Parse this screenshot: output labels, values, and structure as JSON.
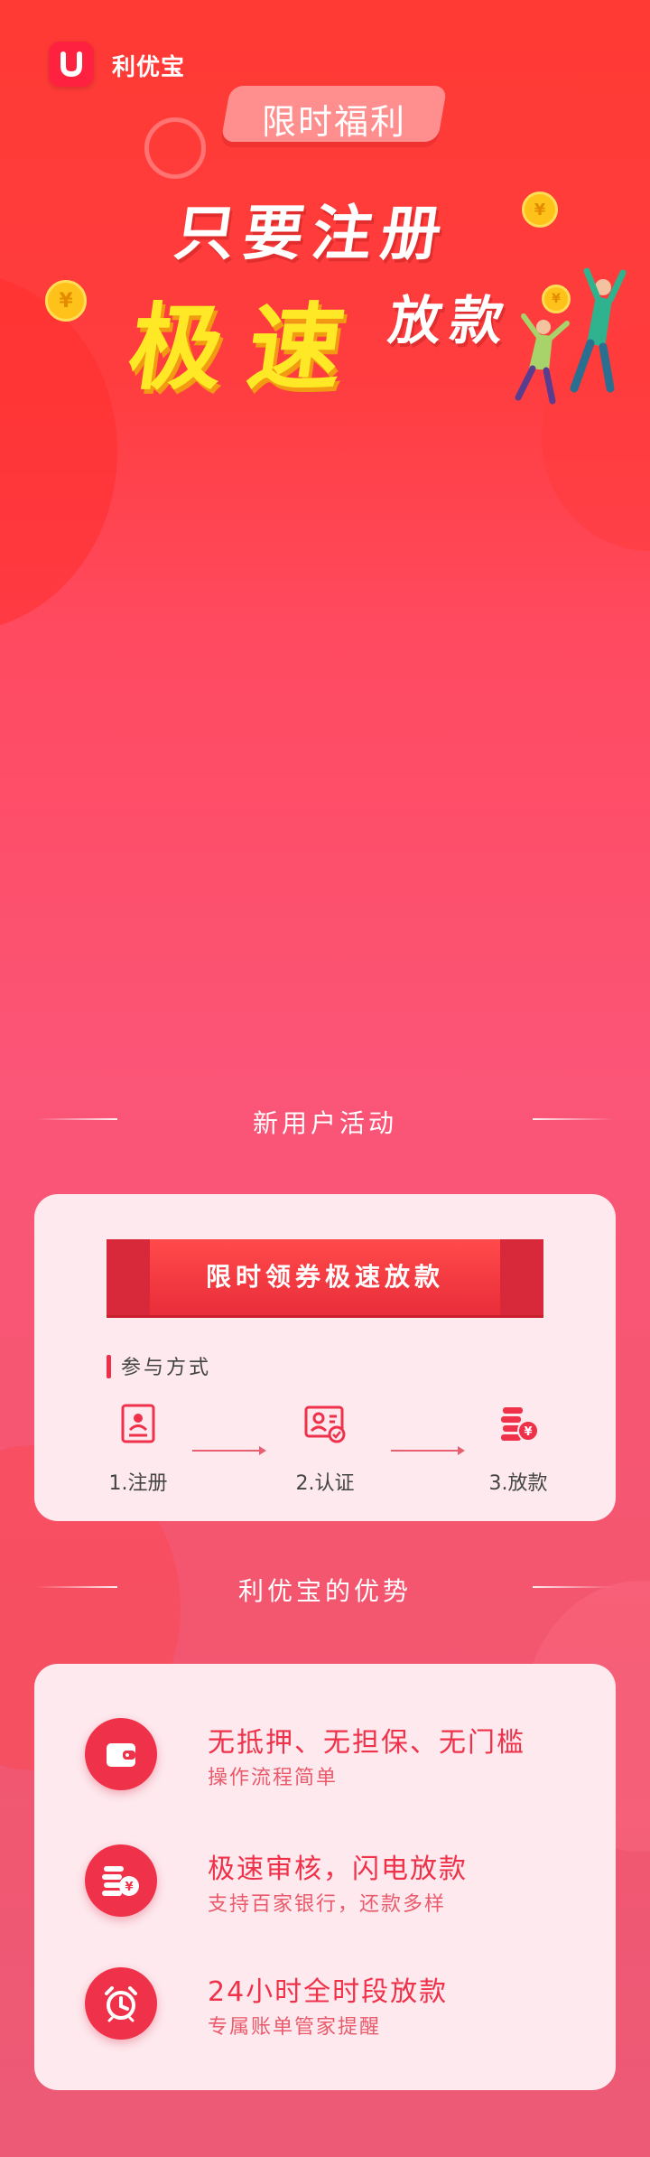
{
  "header": {
    "logo_letter": "U",
    "app_name": "利优宝"
  },
  "hero": {
    "badge": "限时福利",
    "line1": "只要注册",
    "highlight": "极速",
    "suffix": "放款",
    "coin_symbol": "¥"
  },
  "activity": {
    "title": "新用户活动",
    "banner": "限时领券极速放款",
    "section_label": "参与方式",
    "steps": [
      {
        "label": "1.注册",
        "icon": "id-card-icon"
      },
      {
        "label": "2.认证",
        "icon": "verified-user-icon"
      },
      {
        "label": "3.放款",
        "icon": "coin-stack-icon"
      }
    ]
  },
  "advantages": {
    "title": "利优宝的优势",
    "items": [
      {
        "heading": "无抵押、无担保、无门槛",
        "sub": "操作流程简单",
        "icon": "wallet-icon"
      },
      {
        "heading": "极速审核，闪电放款",
        "sub": "支持百家银行，还款多样",
        "icon": "coin-stack-icon"
      },
      {
        "heading": "24小时全时段放款",
        "sub": "专属账单管家提醒",
        "icon": "alarm-clock-icon"
      }
    ]
  },
  "colors": {
    "primary": "#ef3149",
    "highlight_yellow": "#ffe926",
    "card_bg": "#fde9ee"
  }
}
